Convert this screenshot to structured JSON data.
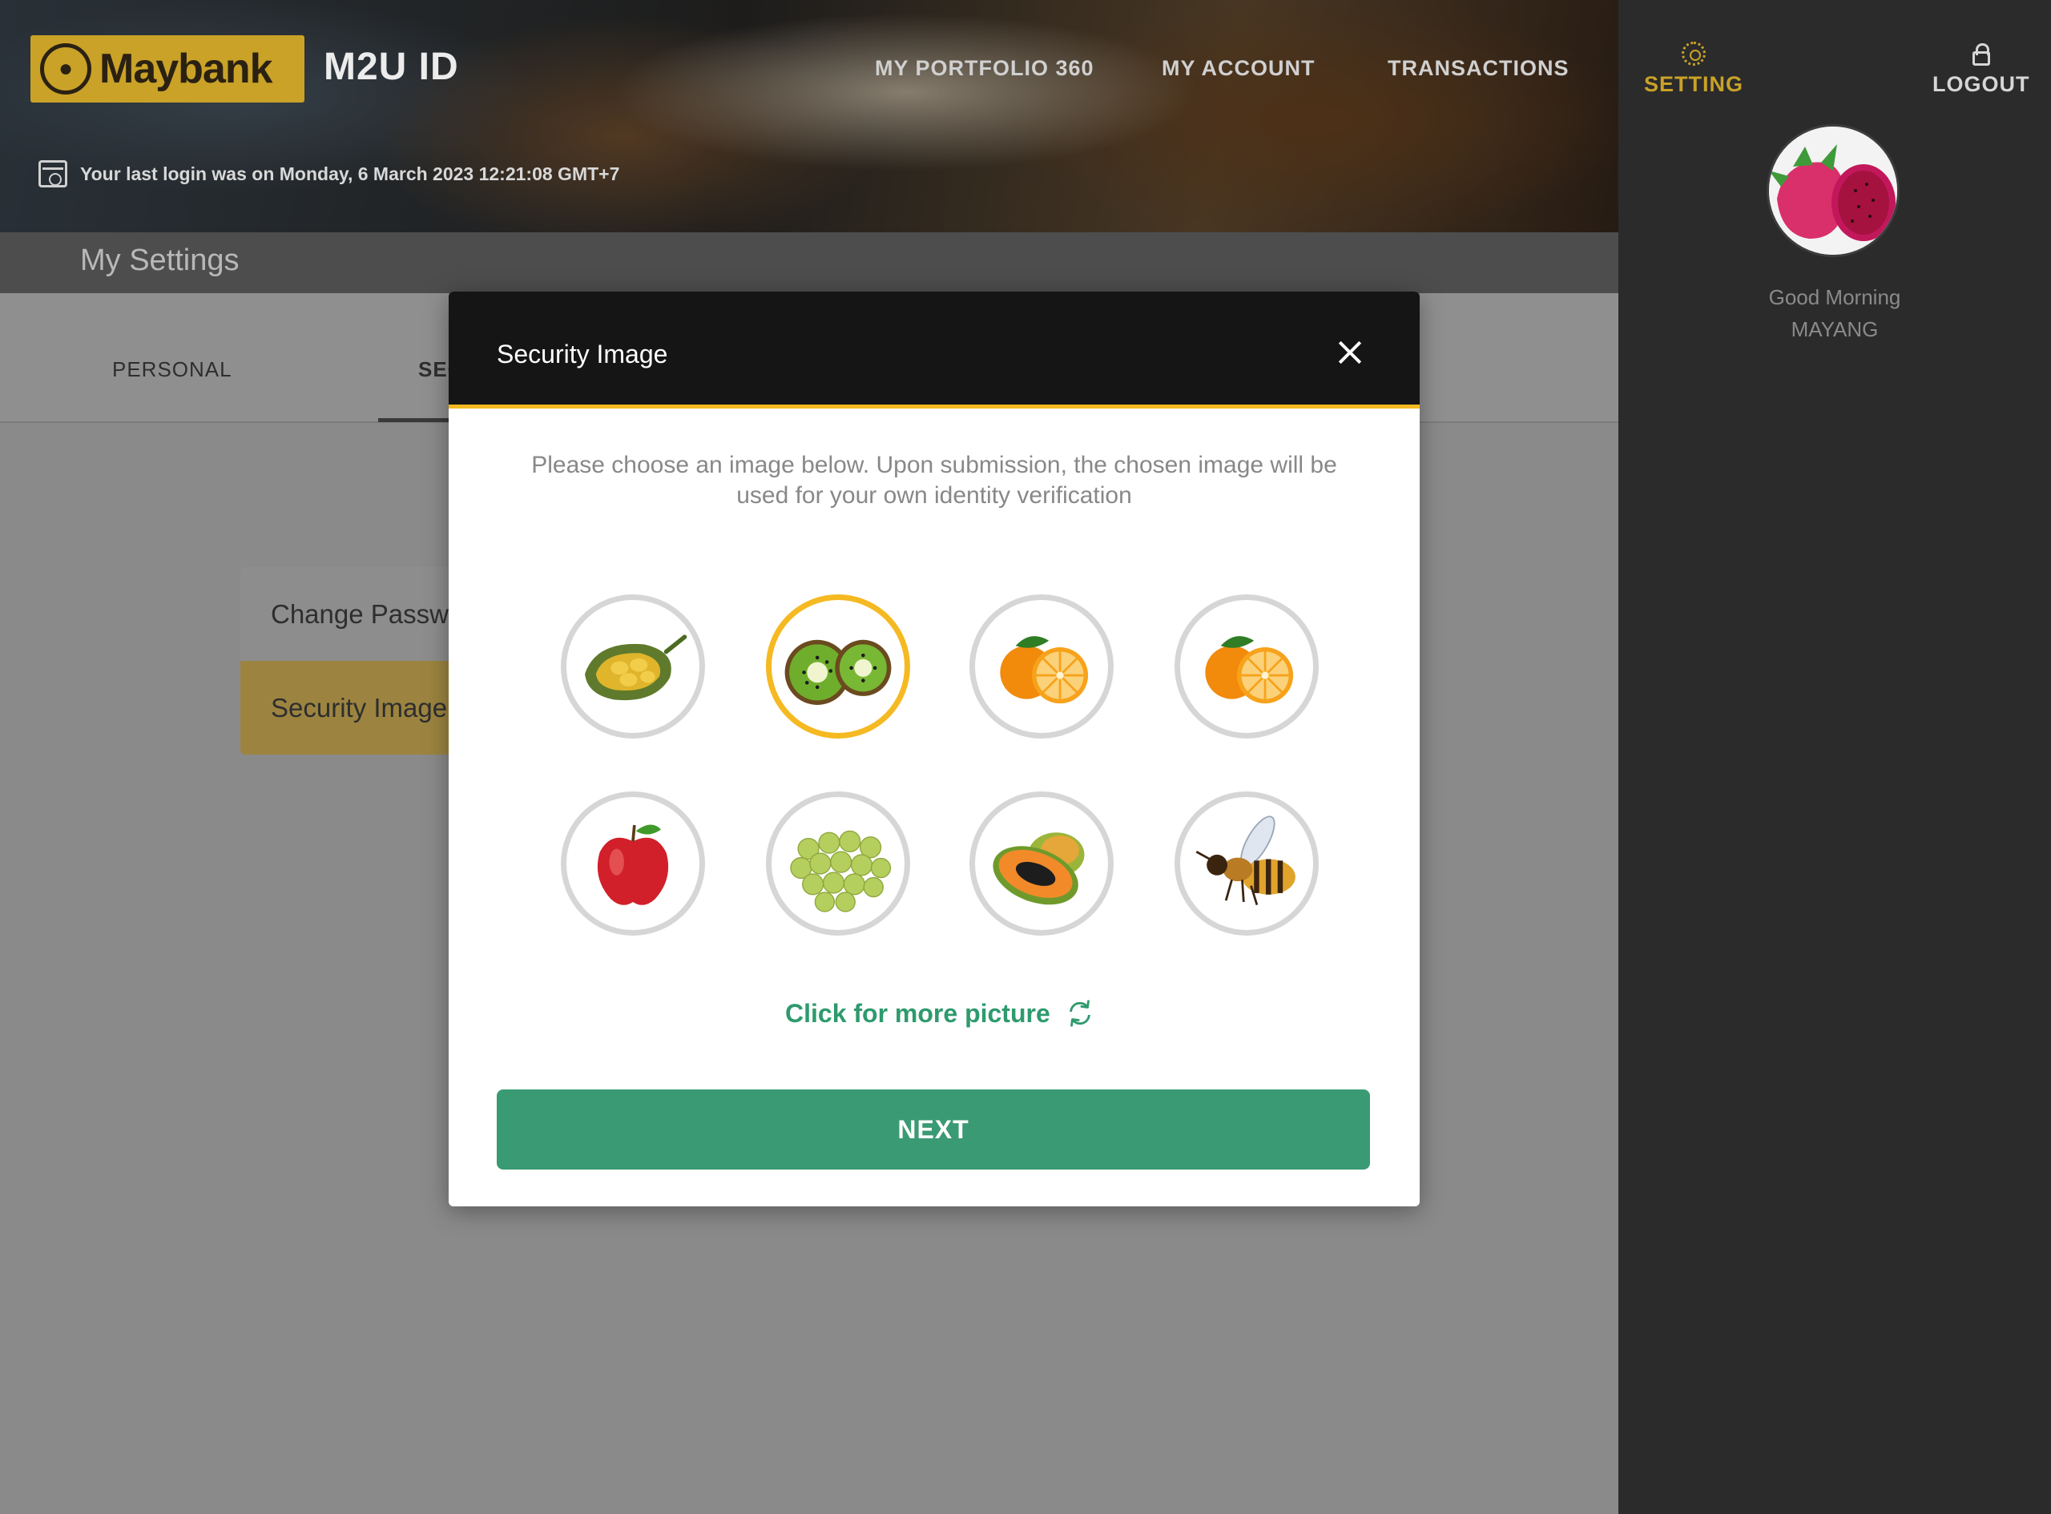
{
  "brand": {
    "logo_text": "Maybank",
    "app_title": "M2U ID"
  },
  "top_nav": {
    "portfolio": "MY PORTFOLIO 360",
    "account": "MY ACCOUNT",
    "transactions": "TRANSACTIONS"
  },
  "last_login": "Your last login was on Monday, 6 March 2023 12:21:08 GMT+7",
  "page_title": "My Settings",
  "tabs": {
    "personal": "PERSONAL",
    "security": "SEC"
  },
  "side_menu": {
    "change_password": "Change Passwo",
    "security_image": "Security Image"
  },
  "right_panel": {
    "setting": "SETTING",
    "logout": "LOGOUT",
    "greeting": "Good Morning",
    "user_name": "MAYANG"
  },
  "modal": {
    "title": "Security Image",
    "instructions": "Please choose an image below. Upon submission, the chosen image will be used for your own identity verification",
    "images": [
      "jackfruit",
      "kiwi",
      "orange",
      "orange",
      "apple",
      "grapes",
      "papaya",
      "bee"
    ],
    "selected_image": "kiwi",
    "more_link": "Click for more picture",
    "next_button": "NEXT"
  },
  "colors": {
    "brand_gold": "#c9a227",
    "accent_yellow": "#f5b921",
    "action_green": "#3a9a73",
    "link_green": "#2e9a6d"
  }
}
